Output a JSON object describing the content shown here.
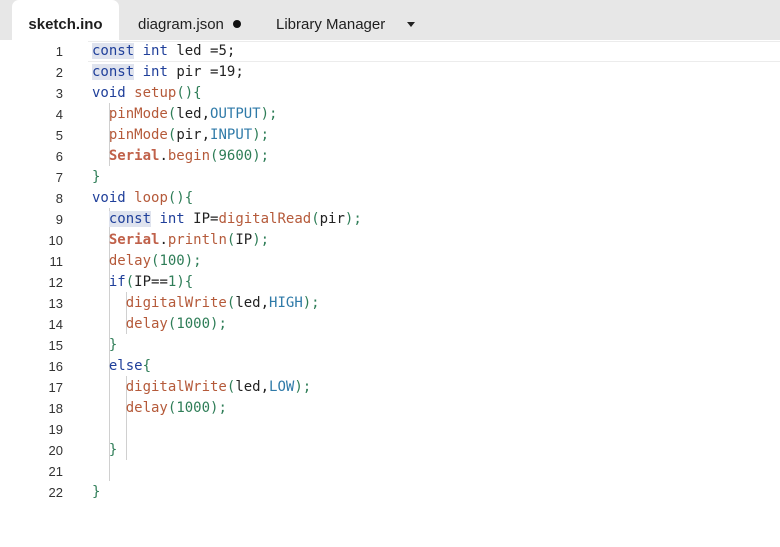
{
  "tabs": [
    {
      "label": "sketch.ino",
      "active": true,
      "modified": false
    },
    {
      "label": "diagram.json",
      "active": false,
      "modified": true
    },
    {
      "label": "Library Manager",
      "active": false,
      "modified": false
    }
  ],
  "dropdown_icon": "caret-down-icon",
  "editor": {
    "active_line": 1,
    "lines": [
      {
        "n": "1",
        "tokens": [
          {
            "t": "const",
            "c": "kw hl"
          },
          {
            "t": " "
          },
          {
            "t": "int",
            "c": "kw"
          },
          {
            "t": " led "
          },
          {
            "t": "=5",
            "c": "op"
          },
          {
            "t": ";"
          }
        ]
      },
      {
        "n": "2",
        "tokens": [
          {
            "t": "const",
            "c": "kw hl"
          },
          {
            "t": " "
          },
          {
            "t": "int",
            "c": "kw"
          },
          {
            "t": " pir "
          },
          {
            "t": "=19",
            "c": "op"
          },
          {
            "t": ";"
          }
        ]
      },
      {
        "n": "3",
        "tokens": [
          {
            "t": "void",
            "c": "kw"
          },
          {
            "t": " "
          },
          {
            "t": "setup",
            "c": "fn"
          },
          {
            "t": "(){",
            "c": "br"
          }
        ]
      },
      {
        "n": "4",
        "tokens": [
          {
            "t": "  "
          },
          {
            "t": "pinMode",
            "c": "fn"
          },
          {
            "t": "(",
            "c": "br"
          },
          {
            "t": "led,"
          },
          {
            "t": "OUTPUT",
            "c": "cn"
          },
          {
            "t": ");",
            "c": "br"
          }
        ]
      },
      {
        "n": "5",
        "tokens": [
          {
            "t": "  "
          },
          {
            "t": "pinMode",
            "c": "fn"
          },
          {
            "t": "(",
            "c": "br"
          },
          {
            "t": "pir,"
          },
          {
            "t": "INPUT",
            "c": "cn"
          },
          {
            "t": ");",
            "c": "br"
          }
        ]
      },
      {
        "n": "6",
        "tokens": [
          {
            "t": "  "
          },
          {
            "t": "Serial",
            "c": "ser"
          },
          {
            "t": "."
          },
          {
            "t": "begin",
            "c": "fn"
          },
          {
            "t": "(",
            "c": "br"
          },
          {
            "t": "9600",
            "c": "num"
          },
          {
            "t": ");",
            "c": "br"
          }
        ]
      },
      {
        "n": "7",
        "tokens": [
          {
            "t": "}",
            "c": "br"
          }
        ]
      },
      {
        "n": "8",
        "tokens": [
          {
            "t": "void",
            "c": "kw"
          },
          {
            "t": " "
          },
          {
            "t": "loop",
            "c": "fn"
          },
          {
            "t": "(){",
            "c": "br"
          }
        ]
      },
      {
        "n": "9",
        "tokens": [
          {
            "t": "  "
          },
          {
            "t": "const",
            "c": "kw hl"
          },
          {
            "t": " "
          },
          {
            "t": "int",
            "c": "kw"
          },
          {
            "t": " IP="
          },
          {
            "t": "digitalRead",
            "c": "fn"
          },
          {
            "t": "(",
            "c": "br"
          },
          {
            "t": "pir"
          },
          {
            "t": ");",
            "c": "br"
          }
        ]
      },
      {
        "n": "10",
        "tokens": [
          {
            "t": "  "
          },
          {
            "t": "Serial",
            "c": "ser"
          },
          {
            "t": "."
          },
          {
            "t": "println",
            "c": "fn"
          },
          {
            "t": "(",
            "c": "br"
          },
          {
            "t": "IP"
          },
          {
            "t": ");",
            "c": "br"
          }
        ]
      },
      {
        "n": "11",
        "tokens": [
          {
            "t": "  "
          },
          {
            "t": "delay",
            "c": "fn"
          },
          {
            "t": "(",
            "c": "br"
          },
          {
            "t": "100",
            "c": "num"
          },
          {
            "t": ");",
            "c": "br"
          }
        ]
      },
      {
        "n": "12",
        "tokens": [
          {
            "t": "  "
          },
          {
            "t": "if",
            "c": "kw"
          },
          {
            "t": "(",
            "c": "br"
          },
          {
            "t": "IP=="
          },
          {
            "t": "1",
            "c": "num"
          },
          {
            "t": "){",
            "c": "br"
          }
        ]
      },
      {
        "n": "13",
        "tokens": [
          {
            "t": "    "
          },
          {
            "t": "digitalWrite",
            "c": "fn"
          },
          {
            "t": "(",
            "c": "br"
          },
          {
            "t": "led,"
          },
          {
            "t": "HIGH",
            "c": "cn"
          },
          {
            "t": ");",
            "c": "br"
          }
        ]
      },
      {
        "n": "14",
        "tokens": [
          {
            "t": "    "
          },
          {
            "t": "delay",
            "c": "fn"
          },
          {
            "t": "(",
            "c": "br"
          },
          {
            "t": "1000",
            "c": "num"
          },
          {
            "t": ");",
            "c": "br"
          }
        ]
      },
      {
        "n": "15",
        "tokens": [
          {
            "t": "  "
          },
          {
            "t": "}",
            "c": "br"
          }
        ]
      },
      {
        "n": "16",
        "tokens": [
          {
            "t": "  "
          },
          {
            "t": "else",
            "c": "kw"
          },
          {
            "t": "{",
            "c": "br"
          }
        ]
      },
      {
        "n": "17",
        "tokens": [
          {
            "t": "    "
          },
          {
            "t": "digitalWrite",
            "c": "fn"
          },
          {
            "t": "(",
            "c": "br"
          },
          {
            "t": "led,"
          },
          {
            "t": "LOW",
            "c": "cn"
          },
          {
            "t": ");",
            "c": "br"
          }
        ]
      },
      {
        "n": "18",
        "tokens": [
          {
            "t": "    "
          },
          {
            "t": "delay",
            "c": "fn"
          },
          {
            "t": "(",
            "c": "br"
          },
          {
            "t": "1000",
            "c": "num"
          },
          {
            "t": ");",
            "c": "br"
          }
        ]
      },
      {
        "n": "19",
        "tokens": []
      },
      {
        "n": "20",
        "tokens": [
          {
            "t": "  "
          },
          {
            "t": "}",
            "c": "br"
          }
        ]
      },
      {
        "n": "21",
        "tokens": []
      },
      {
        "n": "22",
        "tokens": [
          {
            "t": "}",
            "c": "br"
          }
        ]
      }
    ]
  }
}
